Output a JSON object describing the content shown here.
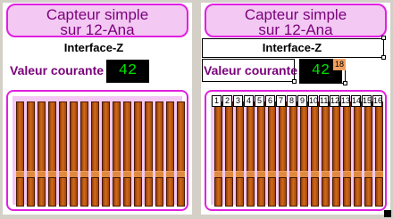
{
  "left_panel": {
    "title_line1": "Capteur simple",
    "title_line2": "sur 12-Ana",
    "interface": "Interface-Z",
    "value_label": "Valeur courante",
    "value": "42",
    "slider_count": 16
  },
  "right_panel": {
    "title_line1": "Capteur simple",
    "title_line2": "sur 12-Ana",
    "interface": "Interface-Z",
    "value_label": "Valeur courante",
    "value": "42",
    "value_badge": "18",
    "slider_numbers": [
      "1",
      "2",
      "3",
      "4",
      "5",
      "6",
      "7",
      "8",
      "9",
      "10",
      "11",
      "12",
      "13",
      "14",
      "15",
      "16"
    ]
  },
  "colors": {
    "title_fill": "#f3c8f3",
    "title_border": "#e020e0",
    "label_text": "#7a007a",
    "value_text": "#00e000",
    "slider_bar": "#d26a1a"
  },
  "icons": [
    "resize-corner-icon"
  ]
}
